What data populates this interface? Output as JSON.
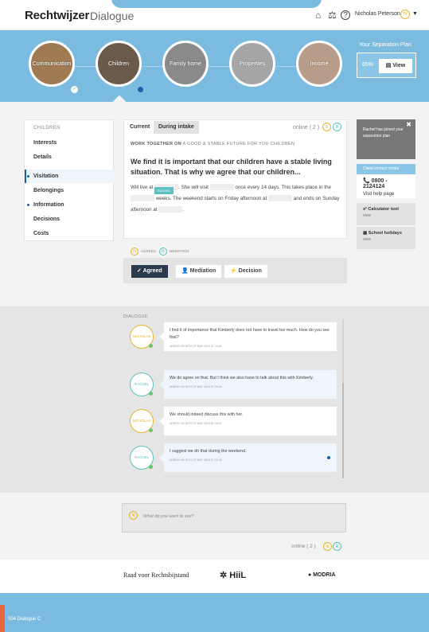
{
  "header": {
    "logo": "Rechtwijzer",
    "section": "Dialogue",
    "user": "Nicholas Peterson",
    "user_initial": "N"
  },
  "hero": {
    "steps": [
      {
        "label": "Communication",
        "color": "#a07a52"
      },
      {
        "label": "Children",
        "color": "#6a5a4a"
      },
      {
        "label": "Family home",
        "color": "#8a8a8a"
      },
      {
        "label": "Properties",
        "color": "#a6a6a6"
      },
      {
        "label": "Income",
        "color": "#b89c8a"
      }
    ],
    "plan_title": "Your Separation Plan",
    "plan_pct": "65%",
    "plan_view": "View"
  },
  "sidebar": {
    "heading": "CHILDREN",
    "items": [
      {
        "label": "Interests"
      },
      {
        "label": "Details"
      },
      {
        "label": "Visitation"
      },
      {
        "label": "Belongings"
      },
      {
        "label": "Information"
      },
      {
        "label": "Decisions"
      },
      {
        "label": "Costs"
      }
    ]
  },
  "main": {
    "tab_current": "Current",
    "tab_intake": "During intake",
    "online": "online ( 2 )",
    "badge_n": "N",
    "badge_r": "R",
    "work_bold": "WORK TOGETHER ON",
    "work_rest": "A GOOD & STABLE FUTURE FOR YOU CHILDREN",
    "headline": "We find it is important that our children have a stable living situation. That is why we agree that our children...",
    "p1": "Will live at",
    "p2": ". She will visit",
    "p3": "once every 14 days. This takes place in the",
    "p4": "weeks. The weekend starts on Friday afternoon at",
    "p5": "and ends on Sunday afternoon at",
    "p6": ".",
    "bubble": "RACHEL",
    "legend_agreed": "AGREED",
    "legend_mediation": "MEDIATION"
  },
  "actions": {
    "agreed": "Agreed",
    "mediation": "Mediation",
    "decision": "Decision"
  },
  "right": {
    "joined": "Rachel has joined your separation plan",
    "contact_head": "Client contact centre",
    "phone": "0800 - 2124124",
    "help": "Visit help page",
    "tool1": "Calculator tool",
    "tool1_sub": "view",
    "tool2": "School holidays",
    "tool2_sub": "view"
  },
  "dialogue": {
    "label": "DIALOGUE",
    "messages": [
      {
        "who": "NICHOLAS",
        "text": "I find it of importance that Kimberly does not have to travel too much. How do you see that?",
        "time": "ADDED ON 18TH OF MAY 2013 AT 14:43"
      },
      {
        "who": "RACHEL",
        "text": "We do agree on that. But I think we also have to talk about this with Kimberly.",
        "time": "ADDED ON 18TH OF MAY 2013 AT 15:14"
      },
      {
        "who": "NICHOLAS",
        "text": "We should indeed discuss this with her.",
        "time": "ADDED ON 18TH OF MAY 2013 AT 15:22"
      },
      {
        "who": "RACHEL",
        "text": "I suggest we do that during the weekend.",
        "time": "ADDED ON 18TH OF MAY 2013 AT 15:34"
      }
    ]
  },
  "composer": {
    "placeholder": "What do you want to say?",
    "online": "online ( 2 )"
  },
  "footer": {
    "logo1": "Raad voor Rechtsbijstand",
    "logo2": "HiiL",
    "logo3": "MODRIA",
    "note": "004 Dialogue C"
  }
}
